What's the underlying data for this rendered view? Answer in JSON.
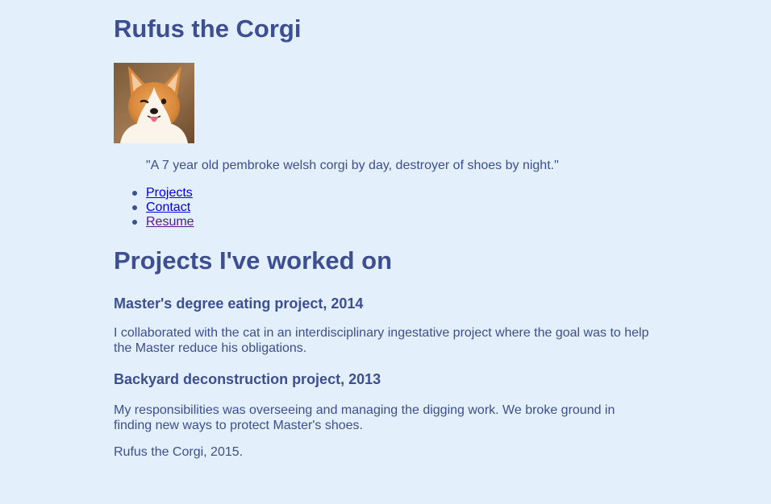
{
  "header": {
    "title": "Rufus the Corgi",
    "avatar_alt": "Photo of a corgi"
  },
  "tagline": "\"A 7 year old pembroke welsh corgi by day, destroyer of shoes by night.\"",
  "nav": {
    "items": [
      {
        "label": "Projects",
        "visited": false
      },
      {
        "label": "Contact",
        "visited": false
      },
      {
        "label": "Resume",
        "visited": true
      }
    ]
  },
  "projects": {
    "heading": "Projects I've worked on",
    "items": [
      {
        "title": "Master's degree eating project, 2014",
        "description": "I collaborated with the cat in an interdisciplinary ingestative project where the goal was to help the Master reduce his obligations."
      },
      {
        "title": "Backyard deconstruction project, 2013",
        "description": "My responsibilities was overseeing and managing the digging work. We broke ground in finding new ways to protect Master's shoes."
      }
    ]
  },
  "footer": {
    "text": "Rufus the Corgi, 2015."
  },
  "colors": {
    "background": "#e3effa",
    "text": "#3d4f91",
    "link": "#0000ee",
    "link_visited": "#551a8b"
  }
}
